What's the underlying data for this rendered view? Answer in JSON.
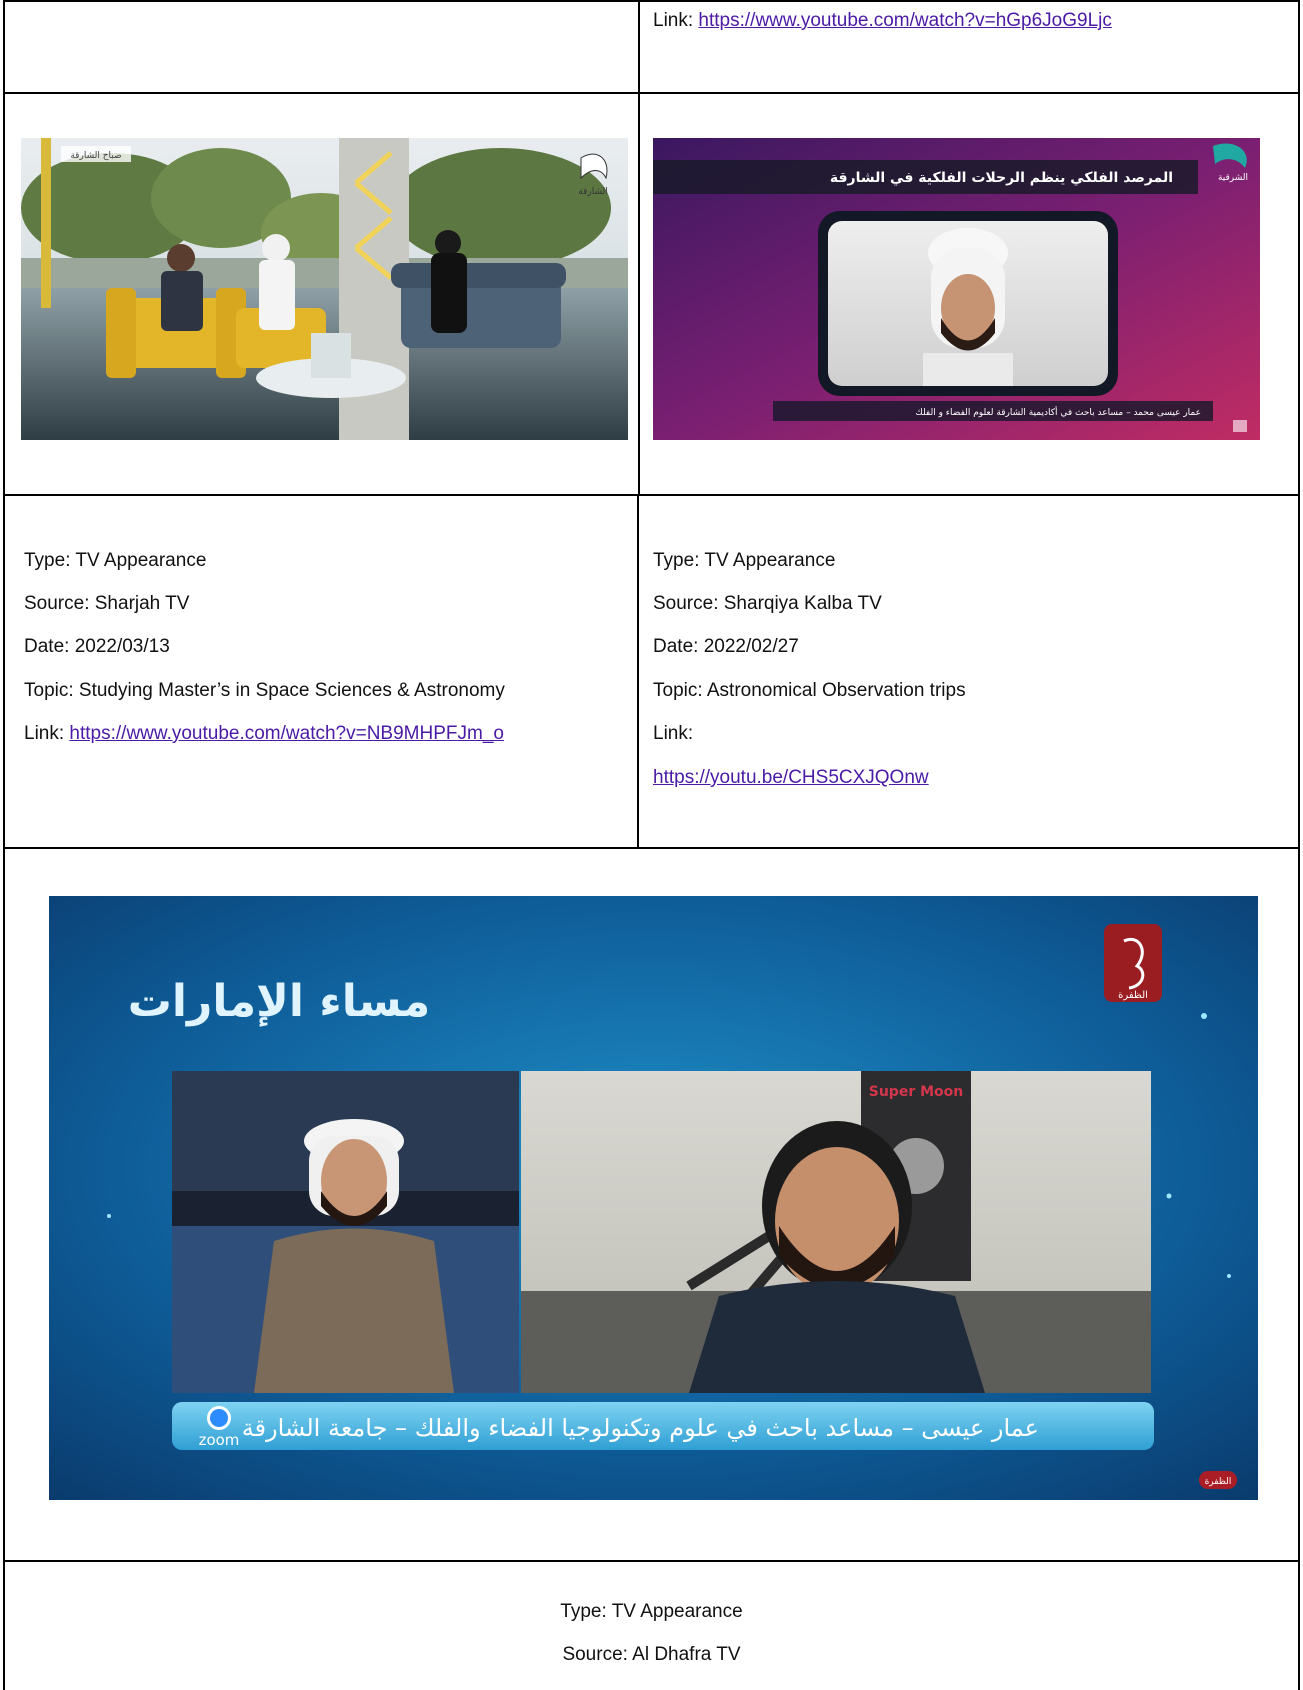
{
  "top_row": {
    "link_label": "Link: ",
    "link_url": "https://www.youtube.com/watch?v=hGp6JoG9Ljc"
  },
  "cell_left": {
    "type": "Type: TV Appearance",
    "source": "Source: Sharjah TV",
    "date": "Date: 2022/03/13",
    "topic": "Topic: Studying Master’s in Space Sciences & Astronomy",
    "link_label": "Link: ",
    "link_url": "https://www.youtube.com/watch?v=NB9MHPFJm_o",
    "image": {
      "studio_tag": "صباح الشارقة",
      "channel_logo": "الشارقة"
    }
  },
  "cell_right": {
    "type": "Type: TV Appearance",
    "source": "Source: Sharqiya Kalba TV",
    "date": "Date: 2022/02/27",
    "topic": "Topic: Astronomical Observation trips",
    "link_label": "Link:",
    "link_url": "https://youtu.be/CHS5CXJQOnw",
    "image": {
      "banner": "المرصد الفلكي ينظم الرحلات الفلكية في الشارقة",
      "channel_logo": "الشرقية",
      "caption": "عمار عيسى محمد – مساعد باحث في أكاديمية الشارقة لعلوم الفضاء و الفلك"
    }
  },
  "bottom_image": {
    "show_logo": "مساء الإمارات",
    "channel_logo": "الظفرة",
    "poster": "Super Moon",
    "ticker": "عمار عيسى – مساعد باحث في علوم وتكنولوجيا الفضاء والفلك – جامعة الشارقة",
    "zoom_label": "zoom",
    "corner_badge": "الظفرة"
  },
  "bottom_text": {
    "type": "Type: TV Appearance",
    "source": "Source: Al Dhafra TV"
  },
  "colors": {
    "link": "#4b1aa6",
    "border": "#000000",
    "studio_blue": "#0d4f86",
    "purple_bg": "#6a1a6e"
  }
}
